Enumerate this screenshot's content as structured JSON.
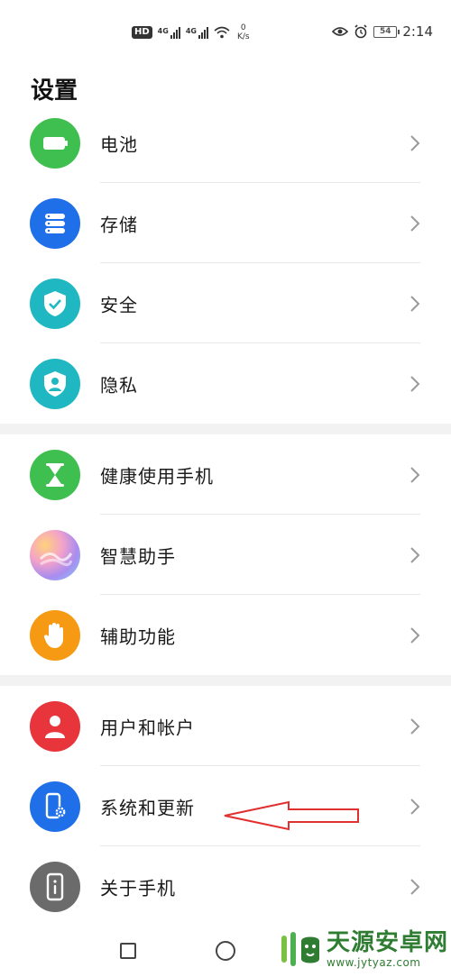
{
  "status_bar": {
    "hd_badge": "HD",
    "net1": "4G",
    "net2": "4G",
    "speed_value": "0",
    "speed_unit": "K/s",
    "battery_level": "54",
    "time": "2:14"
  },
  "header": {
    "title": "设置"
  },
  "groups": [
    {
      "items": [
        {
          "label": "电池",
          "icon": "battery-icon",
          "color": "#3fbf4f"
        },
        {
          "label": "存储",
          "icon": "storage-icon",
          "color": "#1e6fe8"
        },
        {
          "label": "安全",
          "icon": "shield-check-icon",
          "color": "#1fb8c2"
        },
        {
          "label": "隐私",
          "icon": "privacy-icon",
          "color": "#1fb8c2"
        }
      ]
    },
    {
      "items": [
        {
          "label": "健康使用手机",
          "icon": "hourglass-icon",
          "color": "#3fbf4f"
        },
        {
          "label": "智慧助手",
          "icon": "assistant-icon",
          "color": "#b48cf0"
        },
        {
          "label": "辅助功能",
          "icon": "hand-icon",
          "color": "#f59a12"
        }
      ]
    },
    {
      "items": [
        {
          "label": "用户和帐户",
          "icon": "user-icon",
          "color": "#e8353b"
        },
        {
          "label": "系统和更新",
          "icon": "phone-settings-icon",
          "color": "#1e6fe8"
        },
        {
          "label": "关于手机",
          "icon": "phone-info-icon",
          "color": "#6b6b6b"
        }
      ]
    }
  ],
  "watermark": {
    "name": "天源安卓网",
    "url": "www.jytyaz.com"
  },
  "colors": {
    "accent_arrow": "#e03030",
    "watermark_green": "#2f7d32"
  }
}
